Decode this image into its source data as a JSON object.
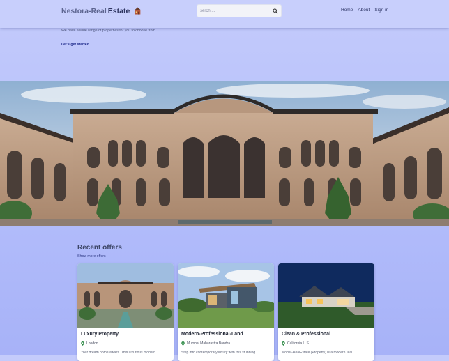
{
  "header": {
    "brand_part1": "Nestora-Real",
    "brand_part2": "Estate",
    "search_placeholder": "serch....",
    "nav": [
      "Home",
      "About",
      "Sign in"
    ]
  },
  "hero": {
    "subtitle": "We have a wide range of properties for you to choose from.",
    "cta": "Let's get started..."
  },
  "offers": {
    "title": "Recent offers",
    "show_more": "Show more offers",
    "cards": [
      {
        "title": "Luxury Property",
        "location": "London",
        "description": "Your dream home awaits. This luxurious modern"
      },
      {
        "title": "Modern-Professional-Land",
        "location": "Mumbai Maharastra Bandra",
        "description": "Step into contemporary luxury with this stunning"
      },
      {
        "title": "Clean & Professional",
        "location": "California U.S",
        "description": "Moder-RealEstate (Property) is a modern real"
      }
    ]
  },
  "colors": {
    "accent": "#1e2a8a",
    "background": "#b6c0fb",
    "nav_bg": "#c8cffc"
  },
  "icons": {
    "brand": "house-icon",
    "search": "search-icon",
    "location": "location-pin-icon"
  }
}
